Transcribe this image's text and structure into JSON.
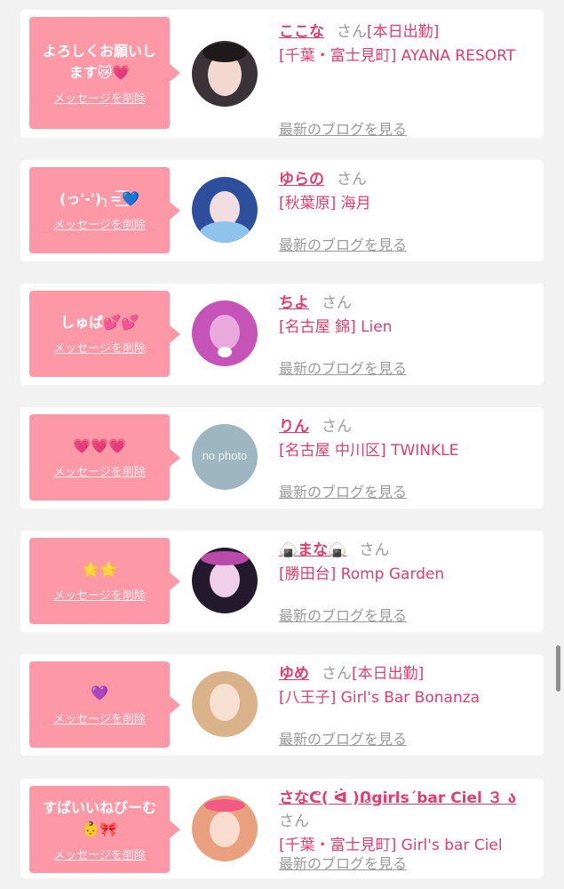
{
  "ui": {
    "delete_label": "メッセージを削除",
    "blog_label": "最新のブログを見る",
    "san_label": "さん",
    "no_photo_text": "no photo"
  },
  "colors": {
    "accent": "#e23d6e",
    "bubble": "#fd98a6",
    "muted": "#999999",
    "background": "#f2f2f2"
  },
  "entries": [
    {
      "message": "よろしくお願いします😿💗",
      "name": "ここな",
      "status": "[本日出勤]",
      "shop": "[千葉・富士見町] AYANA RESORT"
    },
    {
      "message": "(っ'-')╮=͟͟͞͞💙",
      "name": "ゆらの",
      "status": "",
      "shop": "[秋葉原] 海月"
    },
    {
      "message": "しゅぱ💕💕",
      "name": "ちよ",
      "status": "",
      "shop": "[名古屋 錦] Lien"
    },
    {
      "message": "💗💗💗",
      "name": "りん",
      "status": "",
      "shop": "[名古屋 中川区] TWINKLE"
    },
    {
      "message": "🌟🌟",
      "name": "🍙まな🍙",
      "status": "",
      "shop": "[勝田台] Romp Garden"
    },
    {
      "message": "💜",
      "name": "ゆめ",
      "status": "[本日出勤]",
      "shop": "[八王子] Girl's Bar Bonanza"
    },
    {
      "message": "すばいいねびーむ👶🎀",
      "name": "さなᕦ( ᐛ )ᕡgirls´bar Ciel ３ ა",
      "status": "",
      "shop": "[千葉・富士見町] Girl's bar Ciel"
    }
  ]
}
